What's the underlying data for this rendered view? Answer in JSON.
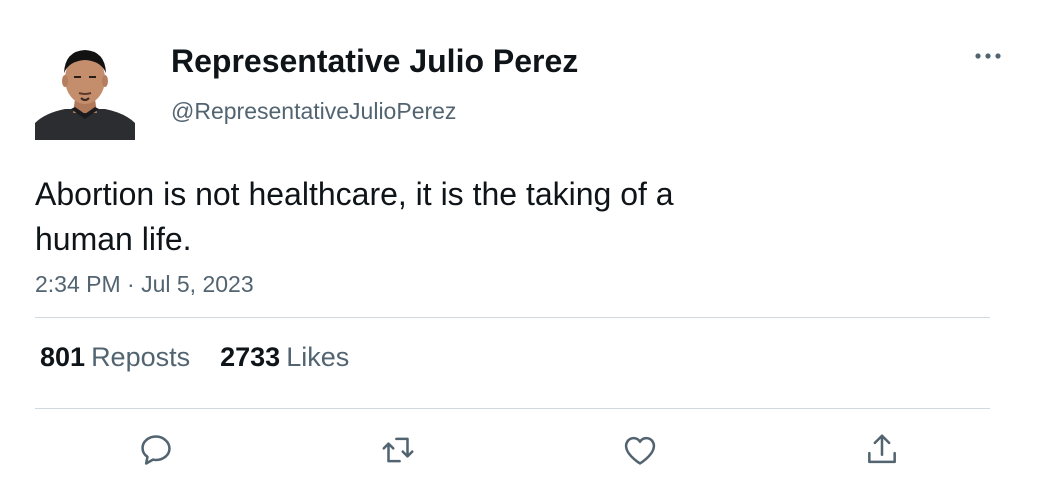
{
  "author": {
    "display_name": "Representative Julio Perez",
    "handle": "@RepresentativeJulioPerez"
  },
  "tweet": {
    "text_line1": "Abortion is not healthcare, it is the taking of a",
    "text_line2": "human life.",
    "timestamp": "2:34 PM · Jul 5, 2023"
  },
  "stats": {
    "reposts_count": "801",
    "reposts_label": "Reposts",
    "likes_count": "2733",
    "likes_label": "Likes"
  },
  "icons": {
    "more": "more-icon",
    "reply": "reply-icon",
    "repost": "repost-icon",
    "like": "like-icon",
    "share": "share-icon"
  },
  "colors": {
    "primary_text": "#0f1419",
    "secondary_text": "#536471",
    "divider": "#cfd9de"
  }
}
